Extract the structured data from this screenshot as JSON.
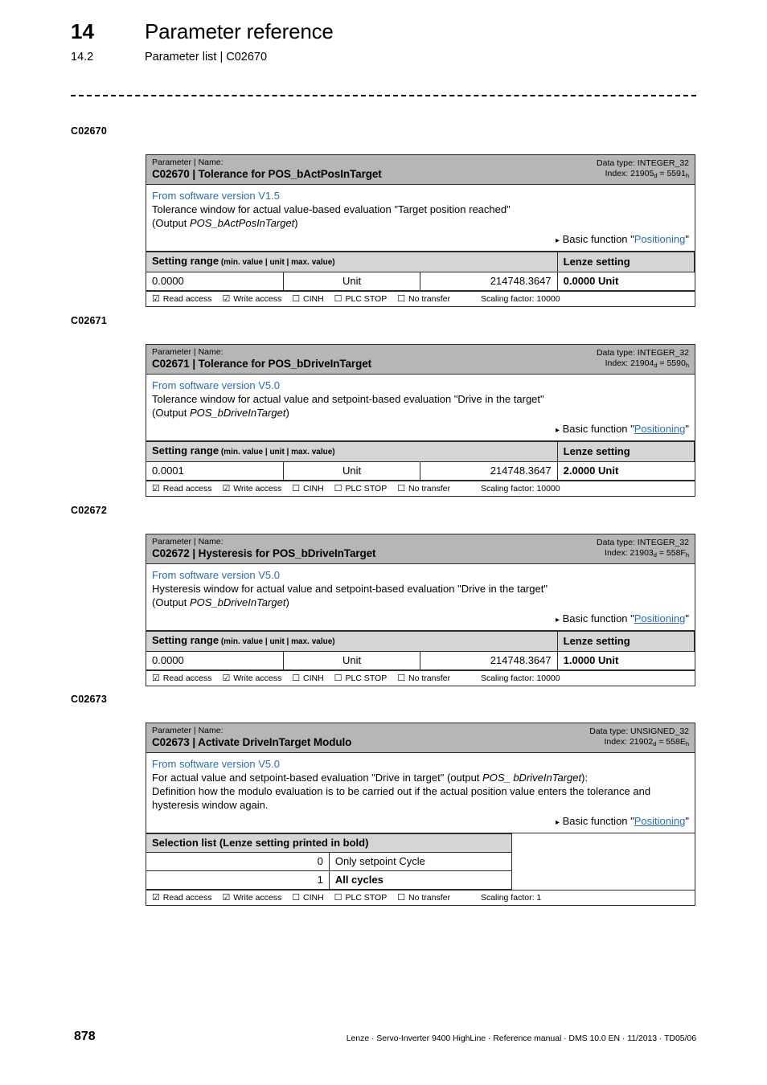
{
  "header": {
    "chapter_number": "14",
    "chapter_title": "Parameter reference",
    "section_number": "14.2",
    "section_title": "Parameter list | C02670"
  },
  "labels": {
    "kicker": "Parameter | Name:",
    "data_type_prefix": "Data type: ",
    "index_prefix": "Index: ",
    "setting_range_header": "Setting range",
    "setting_range_note": " (min. value | unit | max. value)",
    "lenze_setting_header": "Lenze setting",
    "selection_list_header": "Selection list",
    "selection_list_note": " (Lenze setting printed in bold)",
    "basic_function_prefix": "Basic function ",
    "basic_function_link": "Positioning",
    "quote_open": "\"",
    "quote_close": "\"",
    "triangle": "▸",
    "checked_box": "☑",
    "unchecked_box": "☐",
    "read_access": "Read access",
    "write_access": "Write access",
    "cinh": "CINH",
    "plc_stop": "PLC STOP",
    "no_transfer": "No transfer",
    "scaling_factor_prefix": "Scaling factor: "
  },
  "colors": {
    "link": "#2b6cb8",
    "header_band": "#b6b6b6",
    "table_header": "#d5d5d5",
    "border": "#2b2b2b"
  },
  "parameters": [
    {
      "margin_label": "C02670",
      "code": "C02670",
      "name": "Tolerance for POS_bActPosInTarget",
      "title": "C02670 | Tolerance for POS_bActPosInTarget",
      "data_type": "INTEGER_32",
      "index_dec": "21905",
      "index_hex": "5591",
      "software_version": "From software version V1.5",
      "description_line1": "Tolerance window for actual value-based evaluation \"Target position reached\"",
      "description_line2_prefix": "(Output ",
      "description_line2_italic": "POS_bActPosInTarget",
      "description_line2_suffix": ")",
      "description_line3": "",
      "description_line4": "",
      "link_underlined": false,
      "table_type": "setting_range",
      "min_value": "0.0000",
      "unit": "Unit",
      "max_value": "214748.3647",
      "lenze_setting": "0.0000 Unit",
      "scaling_factor": "10000",
      "access": {
        "read_access": true,
        "write_access": true,
        "cinh": false,
        "plc_stop": false,
        "no_transfer": false
      }
    },
    {
      "margin_label": "C02671",
      "code": "C02671",
      "name": "Tolerance for POS_bDriveInTarget",
      "title": "C02671 | Tolerance for POS_bDriveInTarget",
      "data_type": "INTEGER_32",
      "index_dec": "21904",
      "index_hex": "5590",
      "software_version": "From software version V5.0",
      "description_line1": "Tolerance window for actual value and setpoint-based evaluation \"Drive in the target\"",
      "description_line2_prefix": "(Output ",
      "description_line2_italic": "POS_bDriveInTarget",
      "description_line2_suffix": ")",
      "description_line3": "",
      "description_line4": "",
      "link_underlined": true,
      "table_type": "setting_range",
      "min_value": "0.0001",
      "unit": "Unit",
      "max_value": "214748.3647",
      "lenze_setting": "2.0000 Unit",
      "scaling_factor": "10000",
      "access": {
        "read_access": true,
        "write_access": true,
        "cinh": false,
        "plc_stop": false,
        "no_transfer": false
      }
    },
    {
      "margin_label": "C02672",
      "code": "C02672",
      "name": "Hysteresis for POS_bDriveInTarget",
      "title": "C02672 | Hysteresis for POS_bDriveInTarget",
      "data_type": "INTEGER_32",
      "index_dec": "21903",
      "index_hex": "558F",
      "software_version": "From software version V5.0",
      "description_line1": "Hysteresis window for actual value and setpoint-based evaluation \"Drive in the target\"",
      "description_line2_prefix": "(Output ",
      "description_line2_italic": "POS_bDriveInTarget",
      "description_line2_suffix": ")",
      "description_line3": "",
      "description_line4": "",
      "link_underlined": true,
      "table_type": "setting_range",
      "min_value": "0.0000",
      "unit": "Unit",
      "max_value": "214748.3647",
      "lenze_setting": "1.0000 Unit",
      "scaling_factor": "10000",
      "access": {
        "read_access": true,
        "write_access": true,
        "cinh": false,
        "plc_stop": false,
        "no_transfer": false
      }
    },
    {
      "margin_label": "C02673",
      "code": "C02673",
      "name": "Activate DriveInTarget Modulo",
      "title": "C02673 | Activate DriveInTarget Modulo",
      "data_type": "UNSIGNED_32",
      "index_dec": "21902",
      "index_hex": "558E",
      "software_version": "From software version V5.0",
      "description_line1_prefix": "For actual value and setpoint-based evaluation \"Drive in target\" (output ",
      "description_line1_italic": "POS_ bDriveInTarget",
      "description_line1_suffix": "):",
      "description_line3": "Definition how the modulo evaluation is to be carried out if the actual position value enters the tolerance and",
      "description_line4": "hysteresis window again.",
      "link_underlined": true,
      "table_type": "selection_list",
      "selection_list": [
        {
          "code": "0",
          "label": "Only setpoint Cycle",
          "is_lenze_setting": false
        },
        {
          "code": "1",
          "label": "All cycles",
          "is_lenze_setting": true
        }
      ],
      "scaling_factor": "1",
      "access": {
        "read_access": true,
        "write_access": true,
        "cinh": false,
        "plc_stop": false,
        "no_transfer": false
      }
    }
  ],
  "footer": {
    "page_number": "878",
    "credit": "Lenze · Servo-Inverter 9400 HighLine · Reference manual · DMS 10.0 EN · 11/2013 · TD05/06"
  }
}
